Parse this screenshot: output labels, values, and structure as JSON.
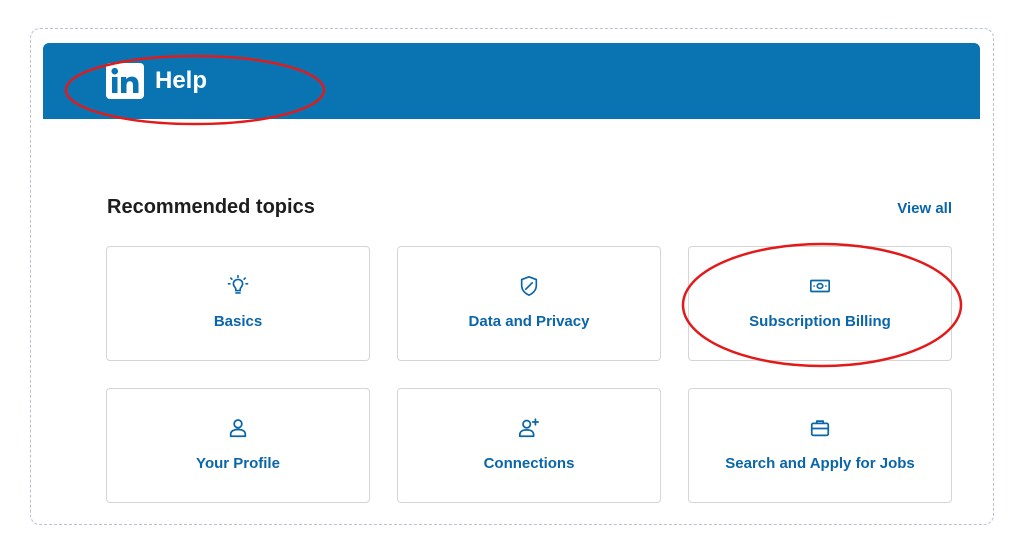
{
  "header": {
    "title": "Help",
    "logo_text": "in",
    "brand_color": "#0a74b3"
  },
  "section": {
    "title": "Recommended topics",
    "view_all_label": "View all"
  },
  "topics": [
    {
      "label": "Basics",
      "icon": "lightbulb-icon"
    },
    {
      "label": "Data and Privacy",
      "icon": "shield-icon"
    },
    {
      "label": "Subscription Billing",
      "icon": "money-bill-icon"
    },
    {
      "label": "Your Profile",
      "icon": "person-icon"
    },
    {
      "label": "Connections",
      "icon": "person-add-icon"
    },
    {
      "label": "Search and Apply for Jobs",
      "icon": "briefcase-icon"
    }
  ],
  "colors": {
    "accent_text": "#0a66a8",
    "annotation": "#e21a1a"
  }
}
